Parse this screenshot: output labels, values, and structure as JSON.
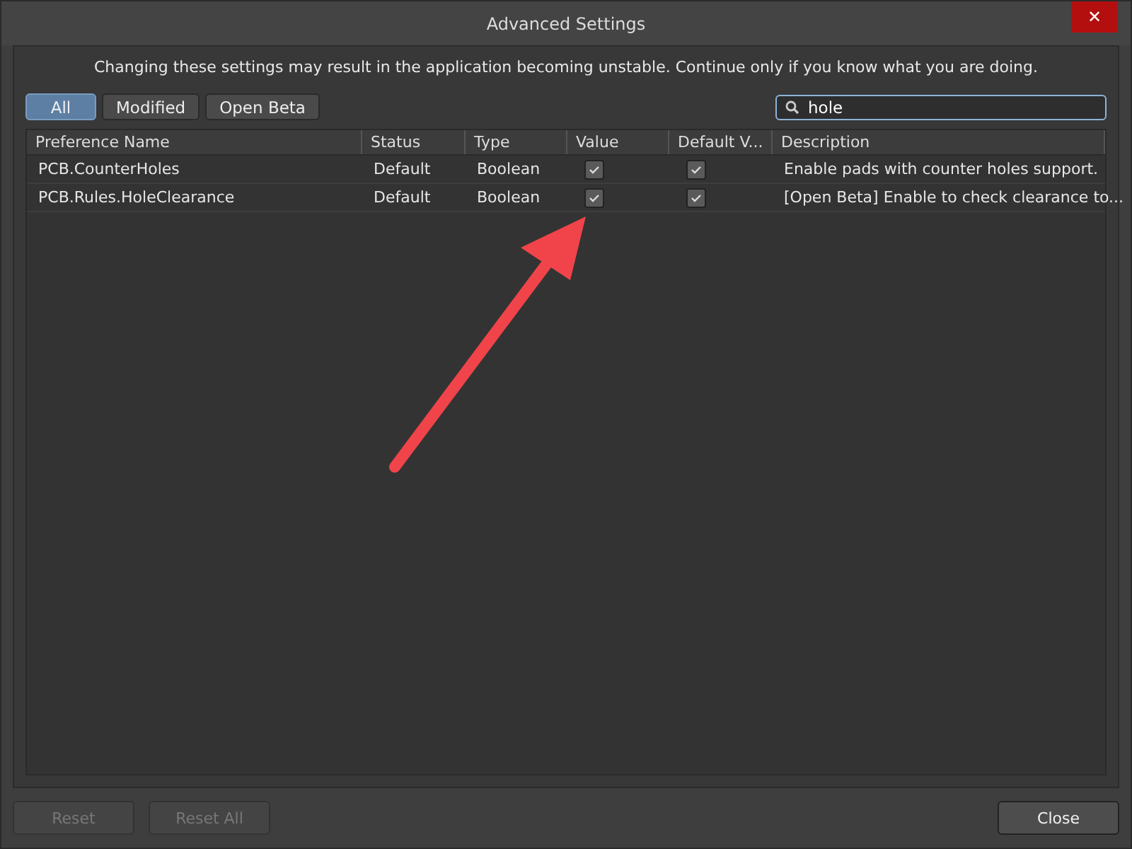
{
  "window": {
    "title": "Advanced Settings",
    "close": "✕"
  },
  "warning": "Changing these settings may result in the application becoming unstable. Continue only if you know what you are doing.",
  "filters": [
    {
      "label": "All",
      "selected": true
    },
    {
      "label": "Modified",
      "selected": false
    },
    {
      "label": "Open Beta",
      "selected": false
    }
  ],
  "search": {
    "value": "hole"
  },
  "table": {
    "columns": [
      "Preference Name",
      "Status",
      "Type",
      "Value",
      "Default V...",
      "Description"
    ],
    "rows": [
      {
        "name": "PCB.CounterHoles",
        "status": "Default",
        "type": "Boolean",
        "value_checked": true,
        "default_checked": true,
        "description": "Enable pads with counter holes support."
      },
      {
        "name": "PCB.Rules.HoleClearance",
        "status": "Default",
        "type": "Boolean",
        "value_checked": true,
        "default_checked": true,
        "description": "[Open Beta] Enable to check clearance to..."
      }
    ]
  },
  "buttons": [
    {
      "label": "Reset",
      "disabled": true
    },
    {
      "label": "Reset All",
      "disabled": true
    },
    {
      "label": "Close",
      "disabled": false
    }
  ]
}
